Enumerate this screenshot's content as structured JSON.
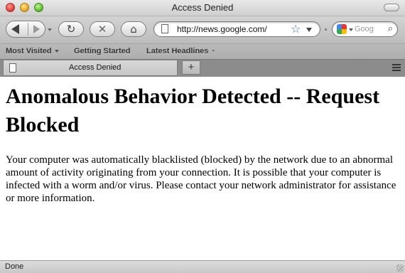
{
  "window": {
    "title": "Access Denied"
  },
  "toolbar": {
    "url": "http://news.google.com/",
    "search_placeholder": "Goog"
  },
  "bookmarks": {
    "items": [
      {
        "label": "Most Visited"
      },
      {
        "label": "Getting Started"
      },
      {
        "label": "Latest Headlines"
      }
    ]
  },
  "tabs": {
    "items": [
      {
        "label": "Access Denied"
      }
    ],
    "new_tab_label": "+"
  },
  "page": {
    "heading": "Anomalous Behavior Detected -- Request Blocked",
    "body": "Your computer was automatically blacklisted (blocked) by the network due to an abnormal amount of activity originating from your connection. It is possible that your computer is infected with a worm and/or virus. Please contact your network administrator for assistance or more information."
  },
  "status": {
    "text": "Done"
  },
  "icons": {
    "back": "back-arrow-icon",
    "forward": "forward-arrow-icon",
    "reload": "reload-icon",
    "stop": "stop-icon",
    "home": "home-icon",
    "page": "page-icon",
    "bookmark": "star-icon",
    "search_engine": "google-icon",
    "search": "magnifier-icon",
    "rss": "rss-icon",
    "tab_list": "list-tabs-icon"
  }
}
